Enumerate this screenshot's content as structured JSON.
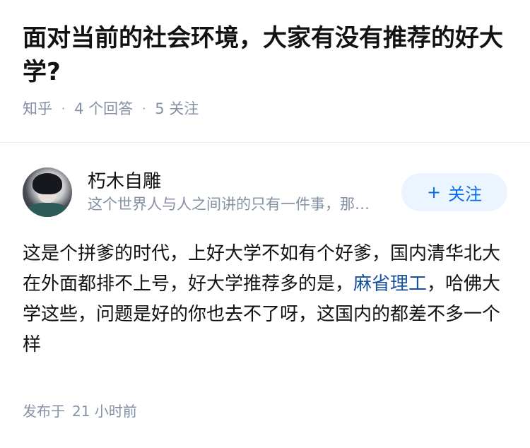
{
  "question": {
    "title": "面对当前的社会环境，大家有没有推荐的好大学?",
    "source": "知乎",
    "answers": "4 个回答",
    "followers": "5 关注"
  },
  "author": {
    "name": "朽木自雕",
    "bio": "这个世界人与人之间讲的只有一件事，那就是利益",
    "follow_label": "关注",
    "follow_icon": "plus-icon"
  },
  "answer": {
    "text_part1": "这是个拼爹的时代，上好大学不如有个好爹，国内清华北大在外面都排不上号，好大学推荐多的是，",
    "link_text": "麻省理工",
    "text_part2": "，哈佛大学这些，问题是好的你也去不了呀，这国内的都差不多一个样"
  },
  "publish": {
    "label": "发布于",
    "time": "21 小时前"
  },
  "colors": {
    "accent": "#056de8",
    "link": "#175199",
    "meta": "#8590a6",
    "follow_bg": "#ebf5ff"
  }
}
